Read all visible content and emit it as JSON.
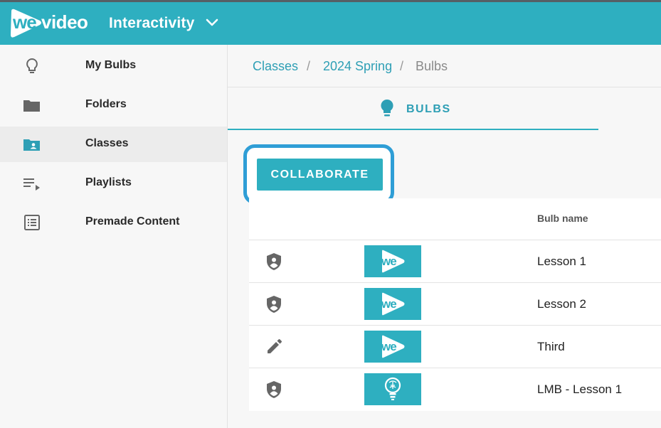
{
  "header": {
    "logo_text": "wevideo",
    "app_name": "Interactivity",
    "brand_color": "#2eafc0"
  },
  "sidebar": {
    "items": [
      {
        "label": "My Bulbs",
        "icon": "lightbulb-outline-icon",
        "active": false
      },
      {
        "label": "Folders",
        "icon": "folder-icon",
        "active": false
      },
      {
        "label": "Classes",
        "icon": "shared-folder-icon",
        "active": true
      },
      {
        "label": "Playlists",
        "icon": "playlist-icon",
        "active": false
      },
      {
        "label": "Premade Content",
        "icon": "list-box-icon",
        "active": false
      }
    ]
  },
  "breadcrumb": {
    "items": [
      "Classes",
      "2024 Spring",
      "Bulbs"
    ],
    "separator": "/"
  },
  "tabs": [
    {
      "label": "BULBS",
      "icon": "lightbulb-icon",
      "active": true
    }
  ],
  "actions": {
    "collaborate_label": "COLLABORATE",
    "highlight_color": "#2f9ed6"
  },
  "table": {
    "columns": [
      "",
      "",
      "Bulb name"
    ],
    "rows": [
      {
        "status_icon": "shield-user-icon",
        "thumbnail": "wevideo-thumbnail",
        "name": "Lesson 1"
      },
      {
        "status_icon": "shield-user-icon",
        "thumbnail": "wevideo-thumbnail",
        "name": "Lesson 2"
      },
      {
        "status_icon": "pencil-icon",
        "thumbnail": "wevideo-thumbnail",
        "name": "Third"
      },
      {
        "status_icon": "shield-user-icon",
        "thumbnail": "lightbulb-brain-thumbnail",
        "name": "LMB - Lesson 1"
      }
    ]
  }
}
